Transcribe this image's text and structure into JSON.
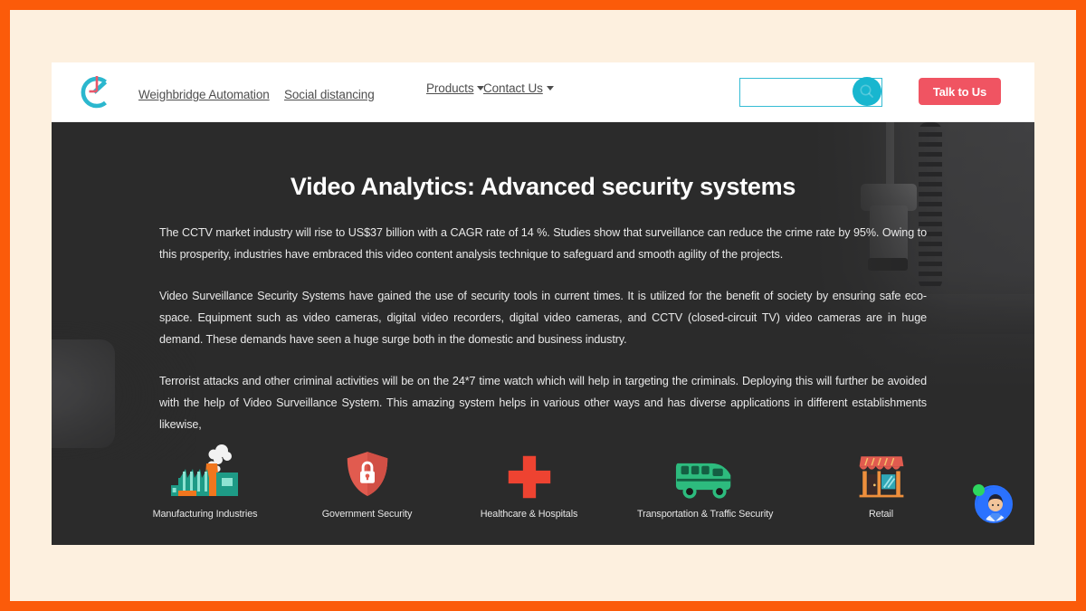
{
  "theme": {
    "frame_border": "#FB5B0A",
    "page_background": "#FDF0DF",
    "header_background": "#FFFFFF",
    "hero_background": "#2B2B2B",
    "accent_teal": "#18B6CF",
    "accent_red": "#F05462",
    "chat_blue": "#1565F0",
    "online_green": "#2DD65F"
  },
  "header": {
    "logo_name": "clock-c-logo",
    "nav": [
      {
        "label": "Weighbridge Automation",
        "has_dropdown": false
      },
      {
        "label": "Social distancing",
        "has_dropdown": false
      },
      {
        "label": "Products",
        "has_dropdown": true
      },
      {
        "label": "Contact Us",
        "has_dropdown": true
      }
    ],
    "search": {
      "value": "",
      "placeholder": "",
      "button_icon": "search-icon"
    },
    "cta": {
      "label": "Talk to Us"
    }
  },
  "hero": {
    "title": "Video Analytics: Advanced security systems",
    "paragraphs": [
      "The CCTV market industry will rise to US$37 billion with a CAGR rate of 14 %. Studies show that surveillance can reduce the crime rate by 95%. Owing to this prosperity, industries have embraced this video content analysis technique to safeguard and smooth agility of the projects.",
      "Video Surveillance Security Systems have gained the use of security tools in current times. It is utilized for the benefit of society by ensuring safe eco-space. Equipment such as video cameras, digital video recorders, digital video cameras, and CCTV (closed-circuit TV) video cameras are in huge demand. These demands have seen a huge surge both in the domestic and business industry.",
      "Terrorist attacks and other criminal activities will be on the 24*7 time watch which will help in targeting the criminals. Deploying this will further be avoided with the help of Video Surveillance System. This amazing system helps in various other ways and has diverse applications in different establishments likewise,"
    ],
    "background_image": "cctv-camera-photo"
  },
  "sectors": [
    {
      "label": "Manufacturing Industries",
      "icon": "factory-icon"
    },
    {
      "label": "Government Security",
      "icon": "shield-lock-icon"
    },
    {
      "label": "Healthcare & Hospitals",
      "icon": "medical-cross-icon"
    },
    {
      "label": "Transportation & Traffic Security",
      "icon": "bus-icon"
    },
    {
      "label": "Retail",
      "icon": "storefront-icon"
    }
  ],
  "chat_widget": {
    "name": "chat-support-avatar",
    "status": "online"
  }
}
